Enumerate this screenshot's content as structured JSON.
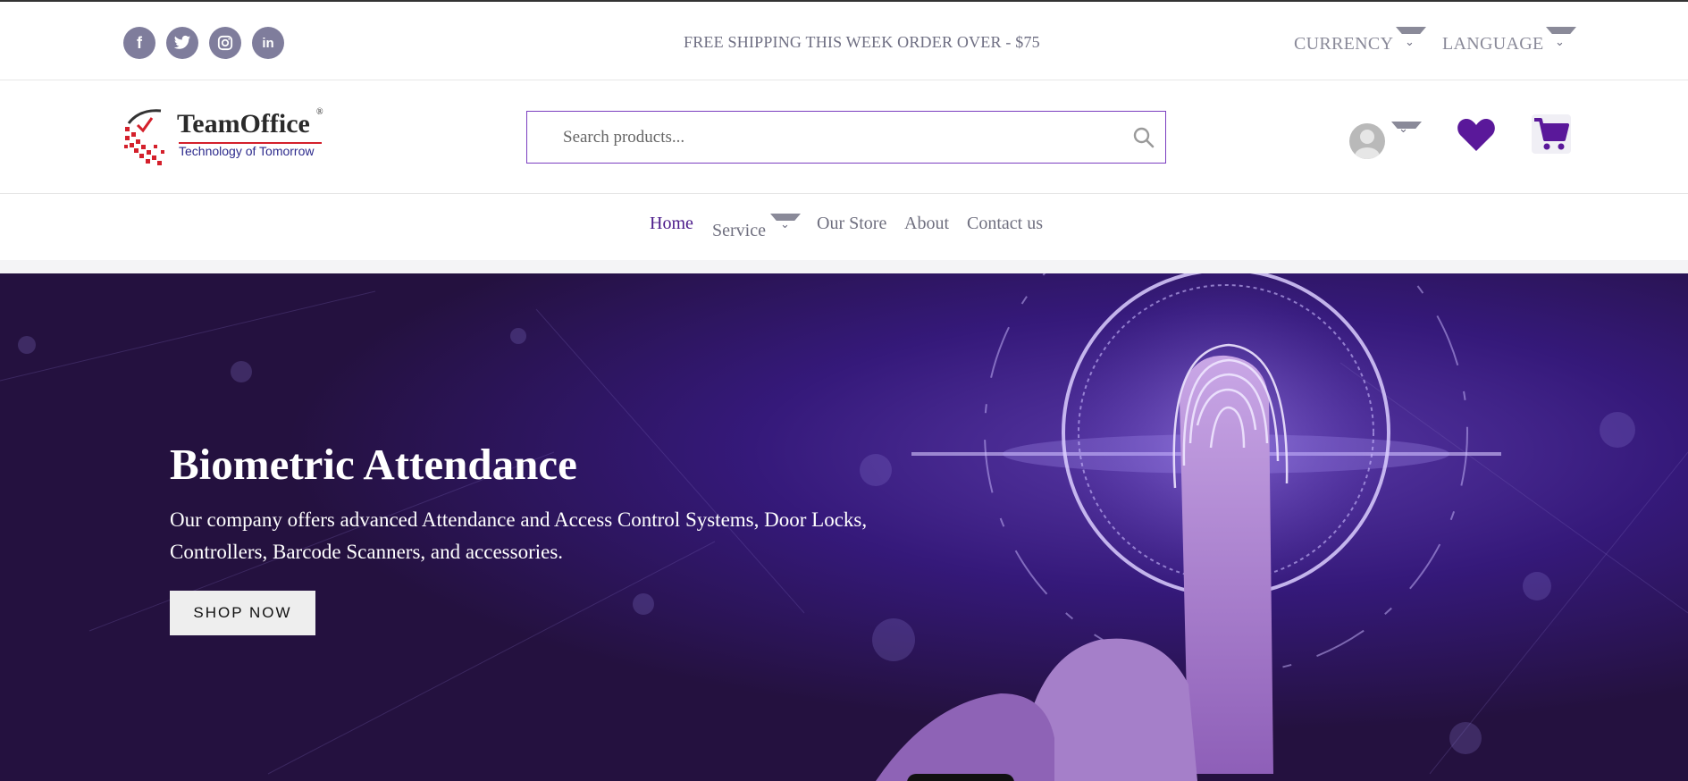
{
  "topbar": {
    "socials": [
      {
        "name": "facebook-icon",
        "glyph": "f"
      },
      {
        "name": "twitter-icon",
        "glyph": "t"
      },
      {
        "name": "instagram-icon",
        "glyph": "◎"
      },
      {
        "name": "linkedin-icon",
        "glyph": "in"
      }
    ],
    "shipping_text": "FREE SHIPPING THIS WEEK ORDER OVER - $75",
    "currency_label": "CURRENCY",
    "language_label": "LANGUAGE"
  },
  "header": {
    "logo_title": "TeamOffice",
    "logo_reg": "®",
    "logo_tagline": "Technology of Tomorrow",
    "search_placeholder": "Search products..."
  },
  "nav": {
    "items": [
      "Home",
      "Service",
      "Our Store",
      "About",
      "Contact us"
    ],
    "active": "Home"
  },
  "hero": {
    "title": "Biometric Attendance",
    "text": "Our company offers advanced Attendance and Access Control Systems, Door Locks, Controllers, Barcode Scanners, and accessories.",
    "button_label": "SHOP NOW"
  },
  "colors": {
    "accent": "#4b1a8a",
    "hero_bg": "#2a144f",
    "social_bg": "#7f7d9c",
    "logo_red": "#d4202b"
  }
}
